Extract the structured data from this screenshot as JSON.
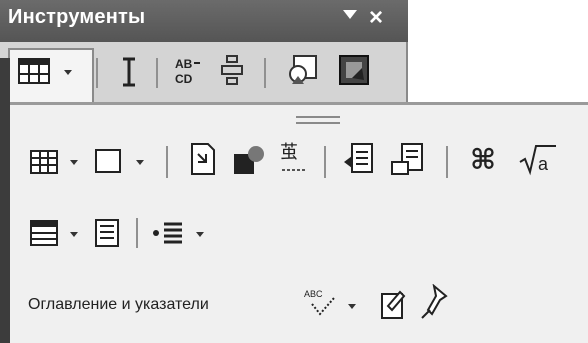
{
  "window": {
    "title": "Инструменты",
    "menu_icon": "dropdown-arrow-icon",
    "close_symbol": "×"
  },
  "row3": {
    "label": "Оглавление и указатели"
  },
  "icons": {
    "row1": [
      "table-icon",
      "text-cursor-icon",
      "spellcheck-abc-icon",
      "wrap-icon",
      "picture-icon",
      "image-dark-icon"
    ],
    "row2": [
      "table-grid-icon",
      "border-box-icon",
      "hyperlink-doc-icon",
      "highlight-icon",
      "text-effects-icon",
      "note-icon",
      "doc-copy-icon",
      "command-icon",
      "square-root-icon"
    ],
    "row3_top": [
      "table-list-icon",
      "list-doc-icon",
      "list-bullets-icon"
    ],
    "row4": [
      "spell-pen-icon",
      "edit-note-icon",
      "pin-icon"
    ]
  },
  "colors": {
    "titlebar": "#5e5e5e",
    "panel": "#f0f0f0",
    "toprow": "#d4d4d4"
  }
}
